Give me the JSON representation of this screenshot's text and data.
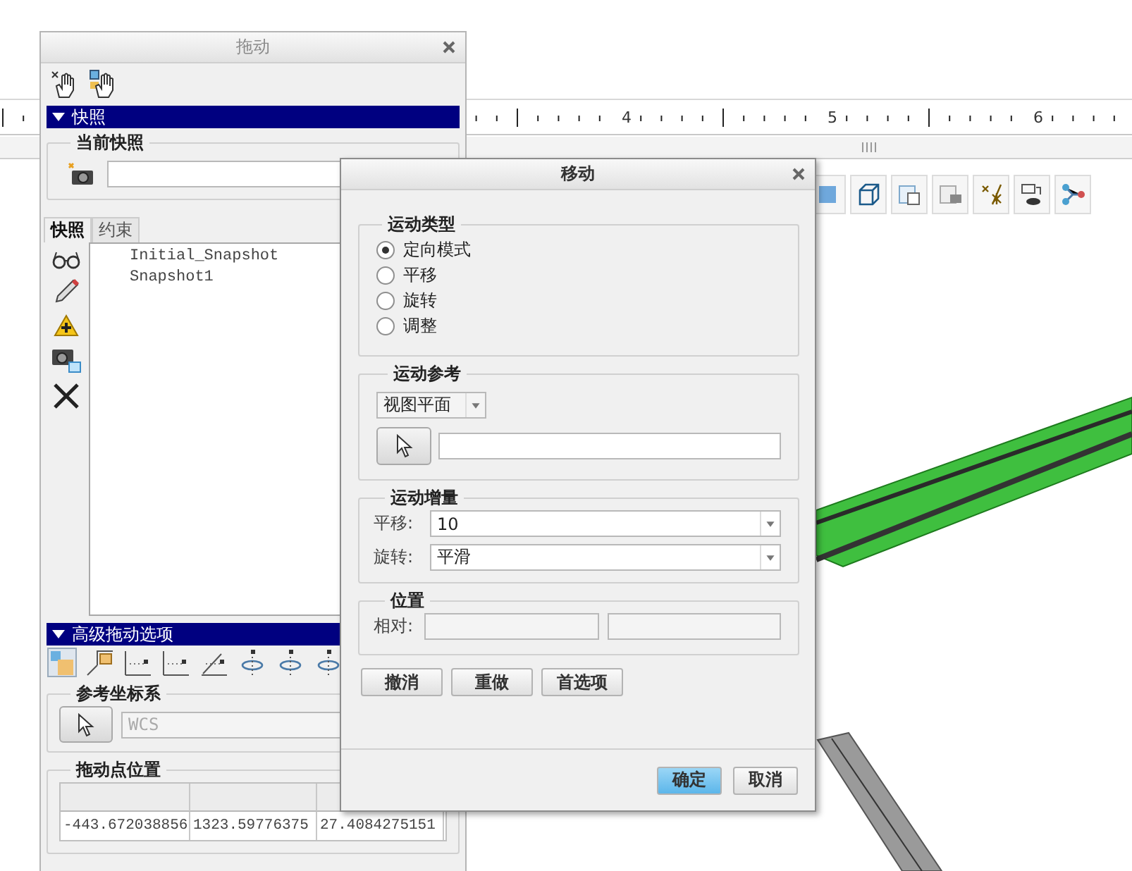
{
  "canvas": {
    "ruler": {
      "labels": [
        "4",
        "5",
        "6"
      ]
    }
  },
  "drag_panel": {
    "title": "拖动",
    "snapshot_section": {
      "header": "快照",
      "expanded": true
    },
    "current_snapshot": {
      "label": "当前快照"
    },
    "tabs": [
      {
        "label": "快照",
        "selected": true
      },
      {
        "label": "约束",
        "selected": false
      }
    ],
    "snapshots": [
      {
        "label": "Initial_Snapshot"
      },
      {
        "label": "Snapshot1"
      }
    ],
    "advanced_section": {
      "header": "高级拖动选项",
      "expanded": true
    },
    "reference_csys": {
      "label": "参考坐标系",
      "value": "WCS",
      "disabled": true
    },
    "drag_point_position": {
      "label": "拖动点位置",
      "values": [
        "-443.672038856",
        "1323.59776375",
        "27.4084275151"
      ]
    }
  },
  "move_dialog": {
    "title": "移动",
    "motion_type": {
      "label": "运动类型",
      "options": [
        {
          "label": "定向模式",
          "selected": true
        },
        {
          "label": "平移",
          "selected": false
        },
        {
          "label": "旋转",
          "selected": false
        },
        {
          "label": "调整",
          "selected": false
        }
      ]
    },
    "motion_reference": {
      "label": "运动参考",
      "dropdown": "视图平面"
    },
    "motion_increment": {
      "label": "运动增量",
      "rows": [
        {
          "label": "平移:",
          "value": "10"
        },
        {
          "label": "旋转:",
          "value": "平滑"
        }
      ]
    },
    "position": {
      "label": "位置",
      "row_label": "相对:"
    },
    "actions": [
      "撤消",
      "重做",
      "首选项"
    ],
    "buttons": [
      {
        "label": "确定",
        "default": true
      },
      {
        "label": "取消",
        "default": false
      }
    ]
  }
}
